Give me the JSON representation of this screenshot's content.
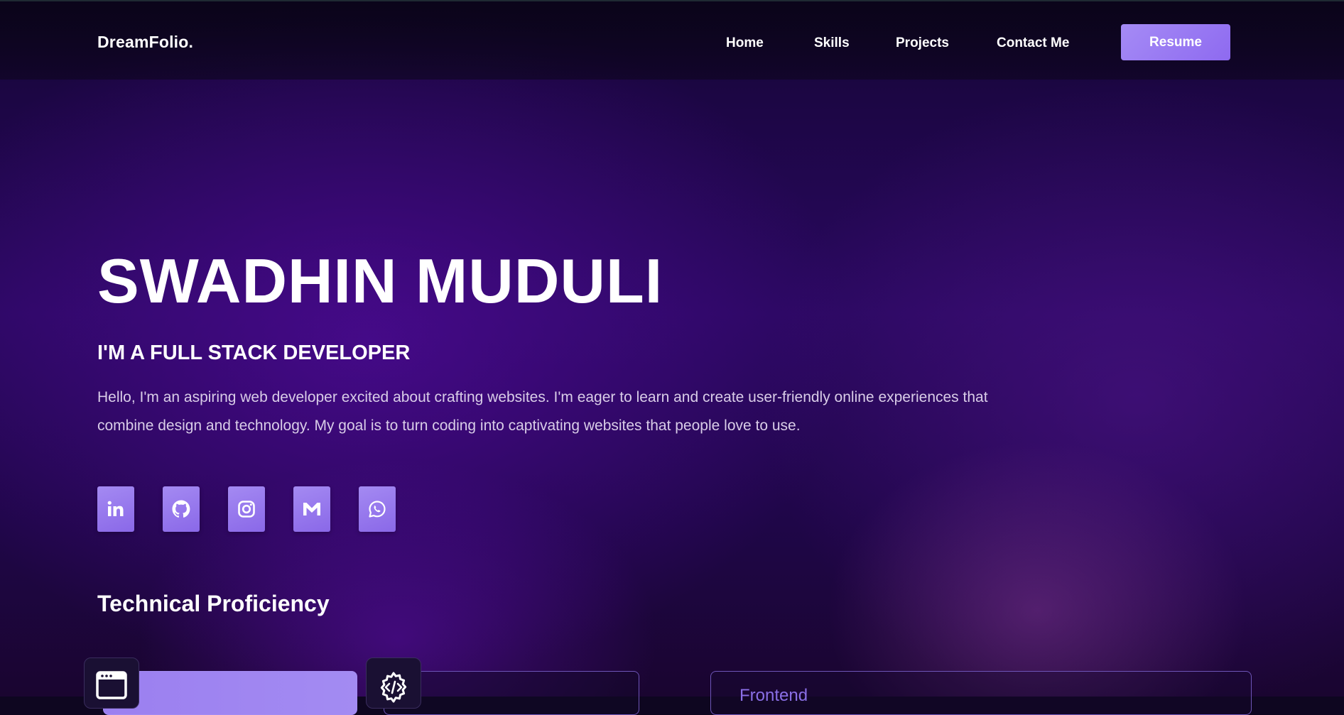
{
  "navbar": {
    "brand": "DreamFolio.",
    "links": [
      {
        "label": "Home"
      },
      {
        "label": "Skills"
      },
      {
        "label": "Projects"
      },
      {
        "label": "Contact Me"
      }
    ],
    "resume_label": "Resume"
  },
  "hero": {
    "name": "SWADHIN MUDULI",
    "role": "I'M A FULL STACK DEVELOPER",
    "description": "Hello, I'm an aspiring web developer excited about crafting websites. I'm eager to learn and create user-friendly online experiences that combine design and technology. My goal is to turn coding into captivating websites that people love to use."
  },
  "socials": [
    {
      "icon": "linkedin-icon"
    },
    {
      "icon": "github-icon"
    },
    {
      "icon": "instagram-icon"
    },
    {
      "icon": "gmail-icon"
    },
    {
      "icon": "whatsapp-icon"
    }
  ],
  "skills_section": {
    "title": "Technical Proficiency",
    "card_icons": [
      "browser-window-icon",
      "code-gear-icon"
    ],
    "right_card_label": "Frontend"
  },
  "colors": {
    "accent": "#9b7ff0",
    "background_dark": "#0e0620",
    "background_purple": "#2a0860",
    "description_text": "#d9cde8"
  }
}
